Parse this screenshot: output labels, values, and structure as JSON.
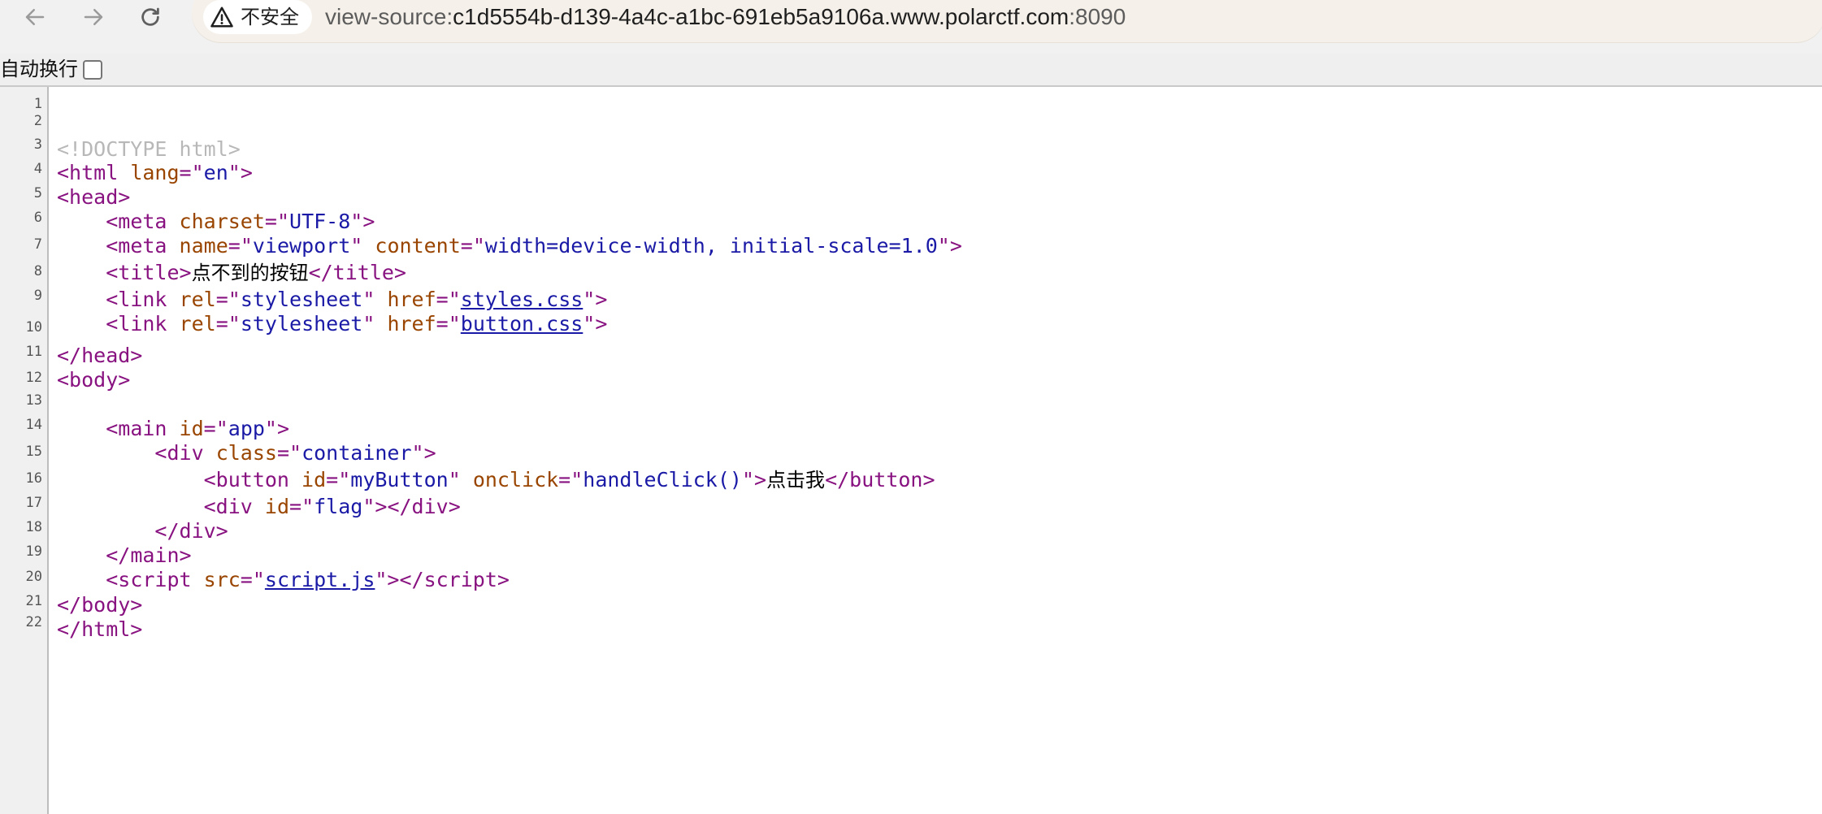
{
  "toolbar": {
    "back_icon": "arrow-left-icon",
    "forward_icon": "arrow-right-icon",
    "reload_icon": "reload-icon",
    "security_icon": "warning-triangle-icon",
    "security_label": "不安全",
    "url_prefix": "view-source:",
    "url_host": "c1d5554b-d139-4a4c-a1bc-691eb5a9106a.www.polarctf.com",
    "url_port": ":8090"
  },
  "wrapbar": {
    "label": "自动换行",
    "checked": false
  },
  "source": {
    "line_numbers": [
      "1",
      "2",
      "3",
      "4",
      "5",
      "6",
      "7",
      "8",
      "9",
      "10",
      "11",
      "12",
      "13",
      "14",
      "15",
      "16",
      "17",
      "18",
      "19",
      "20",
      "21",
      "22"
    ],
    "doctype": "<!DOCTYPE html>",
    "html_lang": "en",
    "meta_charset": "UTF-8",
    "meta_name": "viewport",
    "meta_content": "width=device-width, initial-scale=1.0",
    "title_text": "点不到的按钮",
    "link1_rel": "stylesheet",
    "link1_href": "styles.css",
    "link2_rel": "stylesheet",
    "link2_href": "button.css",
    "main_id": "app",
    "div_class": "container",
    "button_id": "myButton",
    "button_onclick": "handleClick()",
    "button_text": "点击我",
    "flag_id": "flag",
    "script_src": "script.js"
  },
  "colors": {
    "tag": "#881280",
    "attribute": "#994500",
    "value": "#1a1aa6",
    "doctype": "#b8b8b8"
  }
}
